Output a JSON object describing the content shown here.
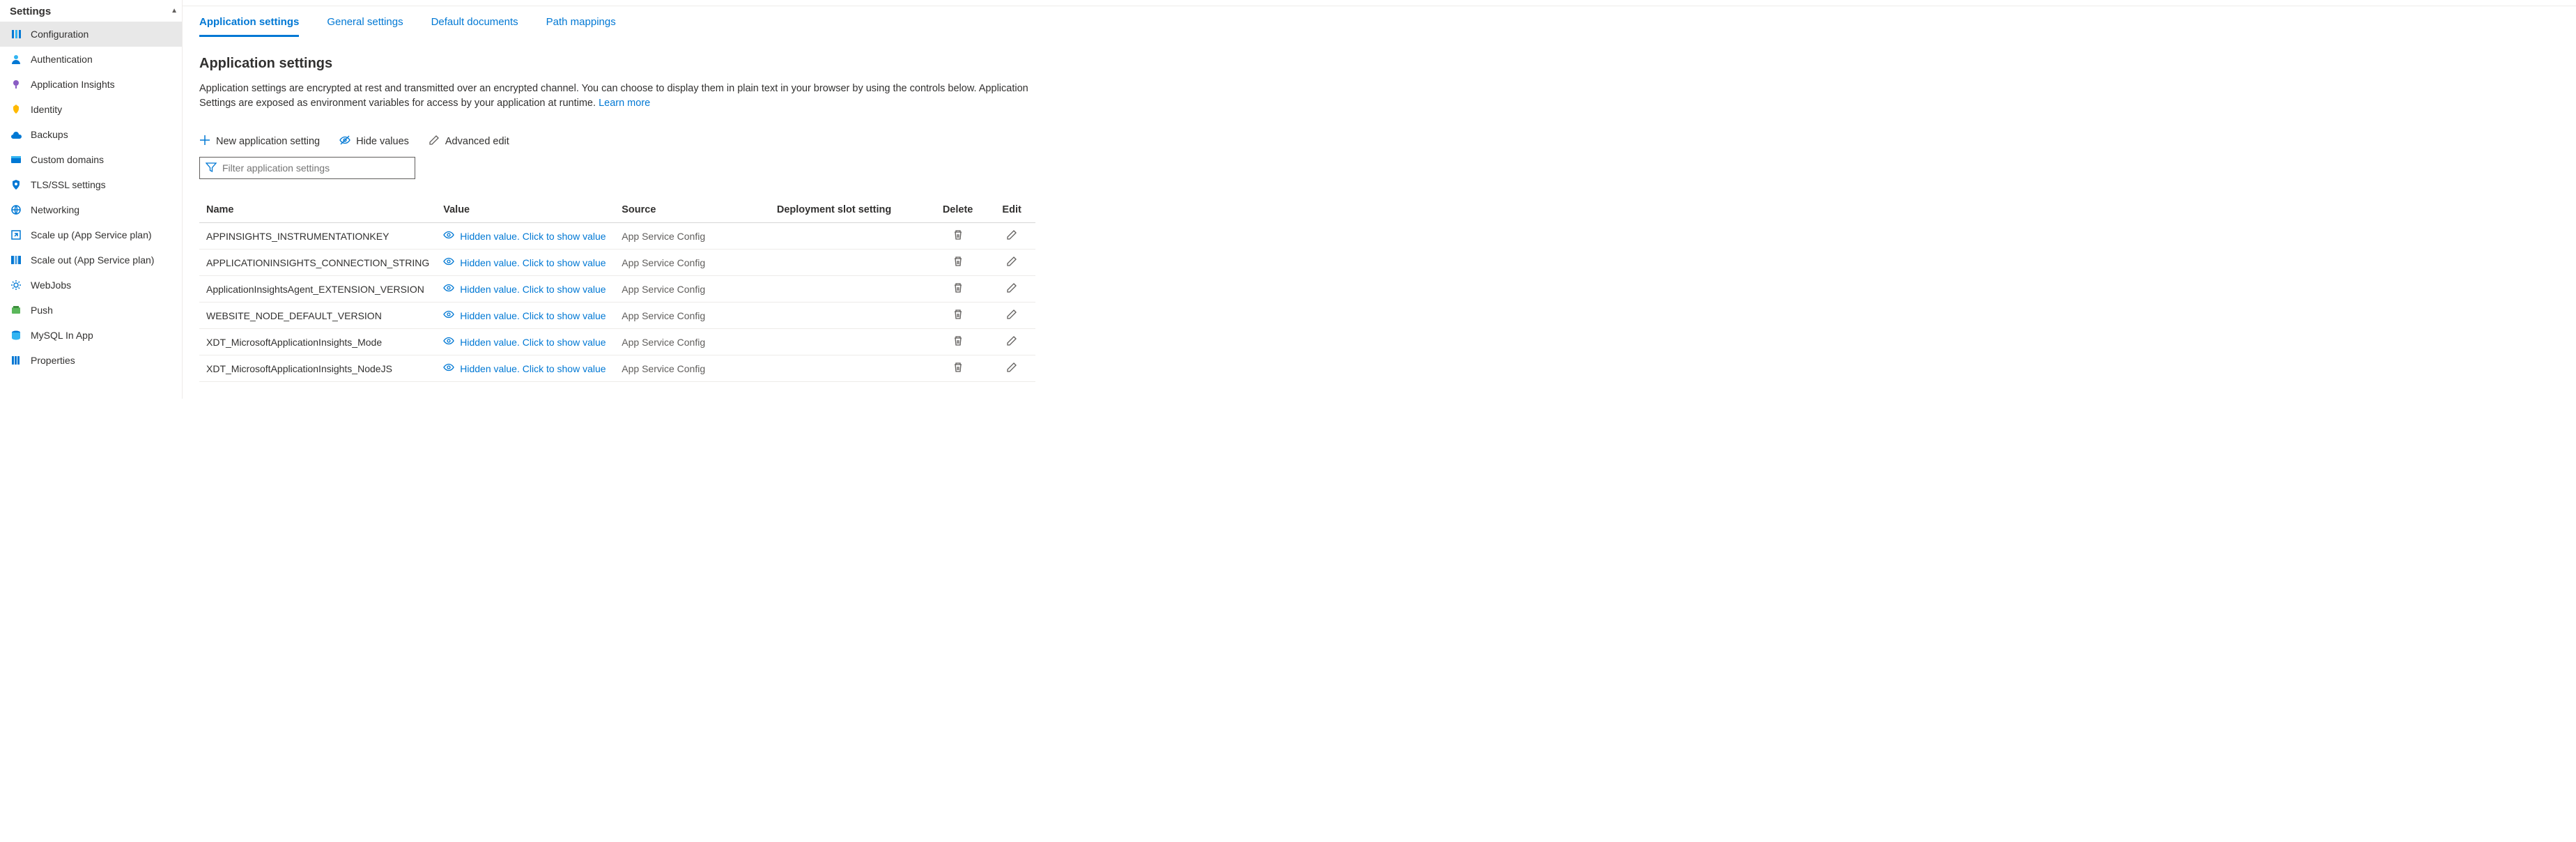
{
  "sidebar": {
    "title": "Settings",
    "items": [
      {
        "label": "Configuration",
        "icon": "config"
      },
      {
        "label": "Authentication",
        "icon": "auth"
      },
      {
        "label": "Application Insights",
        "icon": "insights"
      },
      {
        "label": "Identity",
        "icon": "identity"
      },
      {
        "label": "Backups",
        "icon": "backups"
      },
      {
        "label": "Custom domains",
        "icon": "domains"
      },
      {
        "label": "TLS/SSL settings",
        "icon": "tls"
      },
      {
        "label": "Networking",
        "icon": "networking"
      },
      {
        "label": "Scale up (App Service plan)",
        "icon": "scaleup"
      },
      {
        "label": "Scale out (App Service plan)",
        "icon": "scaleout"
      },
      {
        "label": "WebJobs",
        "icon": "webjobs"
      },
      {
        "label": "Push",
        "icon": "push"
      },
      {
        "label": "MySQL In App",
        "icon": "mysql"
      },
      {
        "label": "Properties",
        "icon": "properties"
      }
    ]
  },
  "tabs": [
    {
      "label": "Application settings"
    },
    {
      "label": "General settings"
    },
    {
      "label": "Default documents"
    },
    {
      "label": "Path mappings"
    }
  ],
  "section": {
    "title": "Application settings",
    "desc": "Application settings are encrypted at rest and transmitted over an encrypted channel. You can choose to display them in plain text in your browser by using the controls below. Application Settings are exposed as environment variables for access by your application at runtime. ",
    "learn_more": "Learn more"
  },
  "toolbar": {
    "new": "New application setting",
    "hide": "Hide values",
    "advanced": "Advanced edit",
    "filter_placeholder": "Filter application settings"
  },
  "table": {
    "headers": {
      "name": "Name",
      "value": "Value",
      "source": "Source",
      "slot": "Deployment slot setting",
      "delete": "Delete",
      "edit": "Edit"
    },
    "hidden_text": "Hidden value. Click to show value",
    "rows": [
      {
        "name": "APPINSIGHTS_INSTRUMENTATIONKEY",
        "source": "App Service Config"
      },
      {
        "name": "APPLICATIONINSIGHTS_CONNECTION_STRING",
        "source": "App Service Config"
      },
      {
        "name": "ApplicationInsightsAgent_EXTENSION_VERSION",
        "source": "App Service Config"
      },
      {
        "name": "WEBSITE_NODE_DEFAULT_VERSION",
        "source": "App Service Config"
      },
      {
        "name": "XDT_MicrosoftApplicationInsights_Mode",
        "source": "App Service Config"
      },
      {
        "name": "XDT_MicrosoftApplicationInsights_NodeJS",
        "source": "App Service Config"
      }
    ]
  }
}
